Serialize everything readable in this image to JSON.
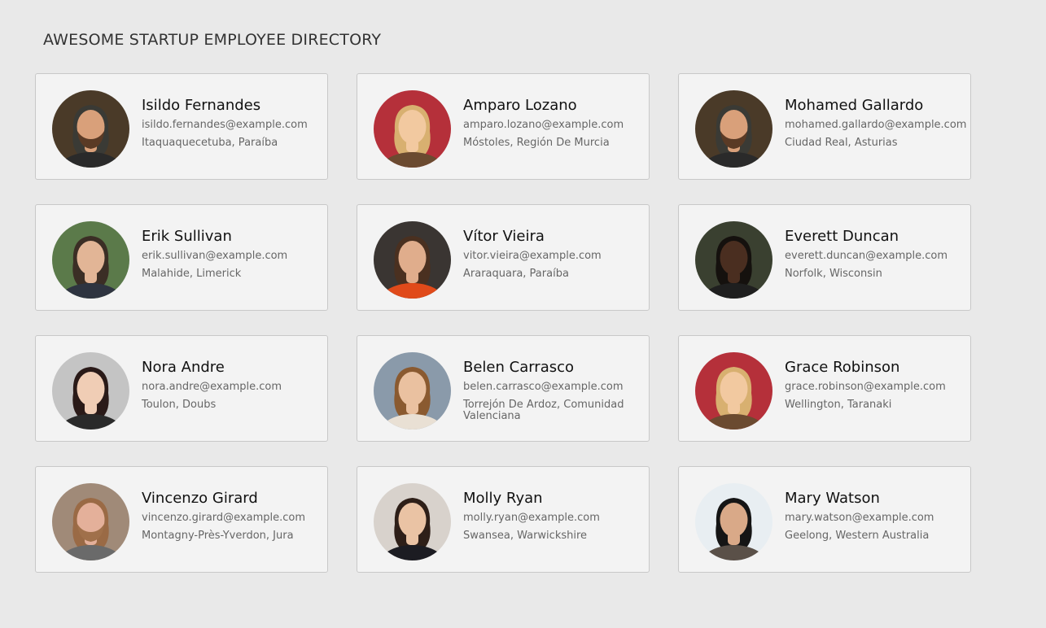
{
  "header": {
    "title": "AWESOME STARTUP EMPLOYEE DIRECTORY"
  },
  "employees": [
    {
      "name": "Isildo Fernandes",
      "email": "isildo.fernandes@example.com",
      "location": "Itaquaquecetuba, Paraíba",
      "avatar": {
        "bg": "#4a3a28",
        "skin": "#d9a07a",
        "hair": "#3a3a35",
        "top": "#2a2a2a",
        "beard": "#5a3a25"
      }
    },
    {
      "name": "Amparo Lozano",
      "email": "amparo.lozano@example.com",
      "location": "Móstoles, Región De Murcia",
      "avatar": {
        "bg": "#b5303a",
        "skin": "#f2c9a0",
        "hair": "#d8b070",
        "top": "#6b4a30",
        "beard": ""
      }
    },
    {
      "name": "Mohamed Gallardo",
      "email": "mohamed.gallardo@example.com",
      "location": "Ciudad Real, Asturias",
      "avatar": {
        "bg": "#4a3a28",
        "skin": "#d9a07a",
        "hair": "#3a3a35",
        "top": "#2a2a2a",
        "beard": "#5a3a25"
      }
    },
    {
      "name": "Erik Sullivan",
      "email": "erik.sullivan@example.com",
      "location": "Malahide, Limerick",
      "avatar": {
        "bg": "#5b7a4a",
        "skin": "#e2b596",
        "hair": "#3b2e25",
        "top": "#2e3440",
        "beard": ""
      }
    },
    {
      "name": "Vítor Vieira",
      "email": "vitor.vieira@example.com",
      "location": "Araraquara, Paraíba",
      "avatar": {
        "bg": "#3a3532",
        "skin": "#e0ad8c",
        "hair": "#4a3020",
        "top": "#e04a1a",
        "beard": ""
      }
    },
    {
      "name": "Everett Duncan",
      "email": "everett.duncan@example.com",
      "location": "Norfolk, Wisconsin",
      "avatar": {
        "bg": "#3a4030",
        "skin": "#4a2e20",
        "hair": "#15110e",
        "top": "#1f1f1f",
        "beard": ""
      }
    },
    {
      "name": "Nora Andre",
      "email": "nora.andre@example.com",
      "location": "Toulon, Doubs",
      "avatar": {
        "bg": "#c4c4c4",
        "skin": "#f0cdb5",
        "hair": "#2a1a18",
        "top": "#2a2a2a",
        "beard": ""
      }
    },
    {
      "name": "Belen Carrasco",
      "email": "belen.carrasco@example.com",
      "location": "Torrejón De Ardoz, Comunidad Valenciana",
      "avatar": {
        "bg": "#8a9aaa",
        "skin": "#eac1a0",
        "hair": "#8a5a30",
        "top": "#e9e0d4",
        "beard": ""
      }
    },
    {
      "name": "Grace Robinson",
      "email": "grace.robinson@example.com",
      "location": "Wellington, Taranaki",
      "avatar": {
        "bg": "#b5303a",
        "skin": "#f2c9a0",
        "hair": "#d8b070",
        "top": "#6b4a30",
        "beard": ""
      }
    },
    {
      "name": "Vincenzo Girard",
      "email": "vincenzo.girard@example.com",
      "location": "Montagny-Près-Yverdon, Jura",
      "avatar": {
        "bg": "#a08a78",
        "skin": "#e4b09a",
        "hair": "#9a6a45",
        "top": "#6a6a6a",
        "beard": "#a0704a"
      }
    },
    {
      "name": "Molly Ryan",
      "email": "molly.ryan@example.com",
      "location": "Swansea, Warwickshire",
      "avatar": {
        "bg": "#d8d2cc",
        "skin": "#eac3a4",
        "hair": "#2e1f18",
        "top": "#1c1c22",
        "beard": ""
      }
    },
    {
      "name": "Mary Watson",
      "email": "mary.watson@example.com",
      "location": "Geelong, Western Australia",
      "avatar": {
        "bg": "#e8eef2",
        "skin": "#d9a988",
        "hair": "#151515",
        "top": "#5a5048",
        "beard": ""
      }
    }
  ]
}
